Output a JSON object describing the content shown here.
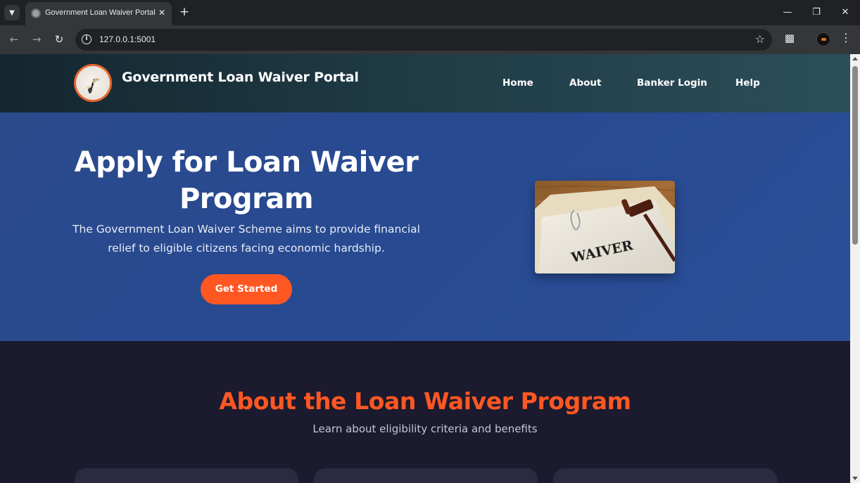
{
  "browser": {
    "tab_title": "Government Loan Waiver Portal",
    "url": "127.0.0.1:5001"
  },
  "header": {
    "site_title": "Government Loan Waiver Portal",
    "nav": [
      "Home",
      "About",
      "Banker Login",
      "Help"
    ]
  },
  "hero": {
    "title_line1": "Apply for Loan Waiver",
    "title_line2": "Program",
    "description_line1": "The Government Loan Waiver Scheme aims to provide financial",
    "description_line2": "relief to eligible citizens facing economic hardship.",
    "cta_label": "Get Started",
    "image_text": "WAIVER"
  },
  "about": {
    "title": "About the Loan Waiver Program",
    "subtitle": "Learn about eligibility criteria and benefits"
  },
  "colors": {
    "accent": "#ff5722",
    "hero_bg": "#284a92",
    "page_bg": "#1b1a2e",
    "header_bg": "#1e3a44"
  }
}
